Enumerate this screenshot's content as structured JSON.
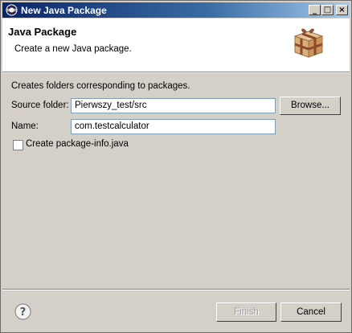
{
  "window": {
    "title": "New Java Package",
    "controls": {
      "minimize": "_",
      "maximize": "□",
      "close": "×"
    }
  },
  "header": {
    "title": "Java Package",
    "description": "Create a new Java package.",
    "icon": "package-icon"
  },
  "body": {
    "intro": "Creates folders corresponding to packages.",
    "source_folder": {
      "label": "Source folder:",
      "value": "Pierwszy_test/src",
      "browse_label": "Browse..."
    },
    "name": {
      "label": "Name:",
      "value": "com.testcalculator"
    },
    "create_info": {
      "label": "Create package-info.java",
      "checked": false
    }
  },
  "footer": {
    "help_icon": "help-icon",
    "finish_label": "Finish",
    "cancel_label": "Cancel"
  }
}
